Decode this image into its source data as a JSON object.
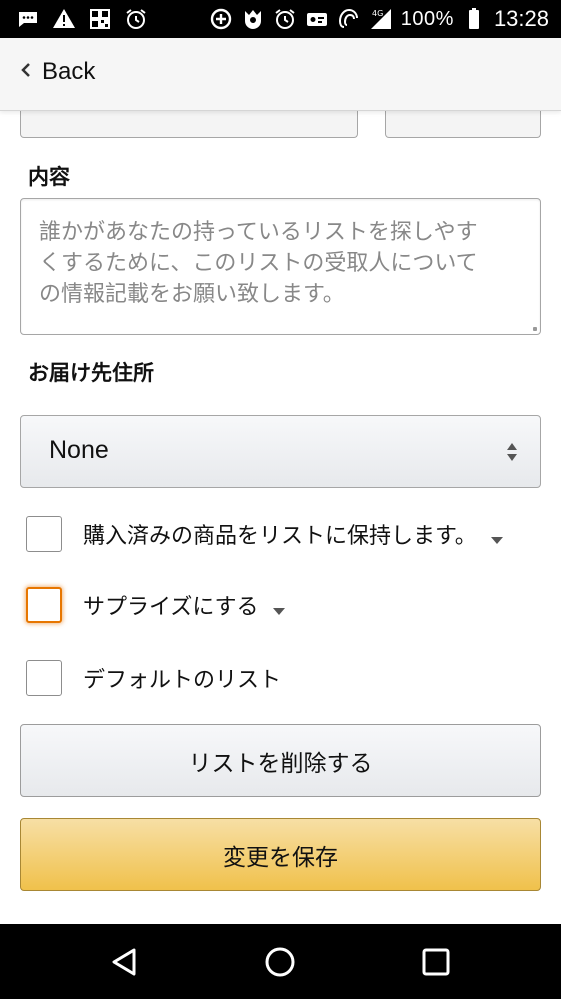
{
  "status_bar": {
    "battery_percent": "100%",
    "time": "13:28",
    "left_icons": [
      "messages-icon",
      "warning-icon",
      "qr-app-icon",
      "alarm-icon"
    ],
    "right_icons": [
      "data-saver-icon",
      "app-notification-icon",
      "alarm-icon",
      "vpn-icon",
      "nfc-icon",
      "signal-4g-icon",
      "battery-icon"
    ]
  },
  "header": {
    "back_label": "Back"
  },
  "form": {
    "description_label": "内容",
    "description_placeholder_lines": [
      "誰かがあなたの持っているリストを探しやす",
      "くするために、このリストの受取人について",
      "の情報記載をお願い致します。"
    ],
    "address_label": "お届け先住所",
    "address_select_value": "None",
    "checkboxes": [
      {
        "label": "購入済みの商品をリストに保持します。",
        "checked": false,
        "has_info_caret": true
      },
      {
        "label": "サプライズにする",
        "checked": false,
        "has_info_caret": true,
        "focused": true
      },
      {
        "label": "デフォルトのリスト",
        "checked": false,
        "has_info_caret": false
      }
    ],
    "delete_button_label": "リストを削除する",
    "save_button_label": "変更を保存"
  },
  "nav_bar": {
    "buttons": [
      "back-triangle-icon",
      "home-circle-icon",
      "recents-square-icon"
    ]
  },
  "colors": {
    "accent_primary": "#f0c14b",
    "focus_ring": "#e77600"
  }
}
